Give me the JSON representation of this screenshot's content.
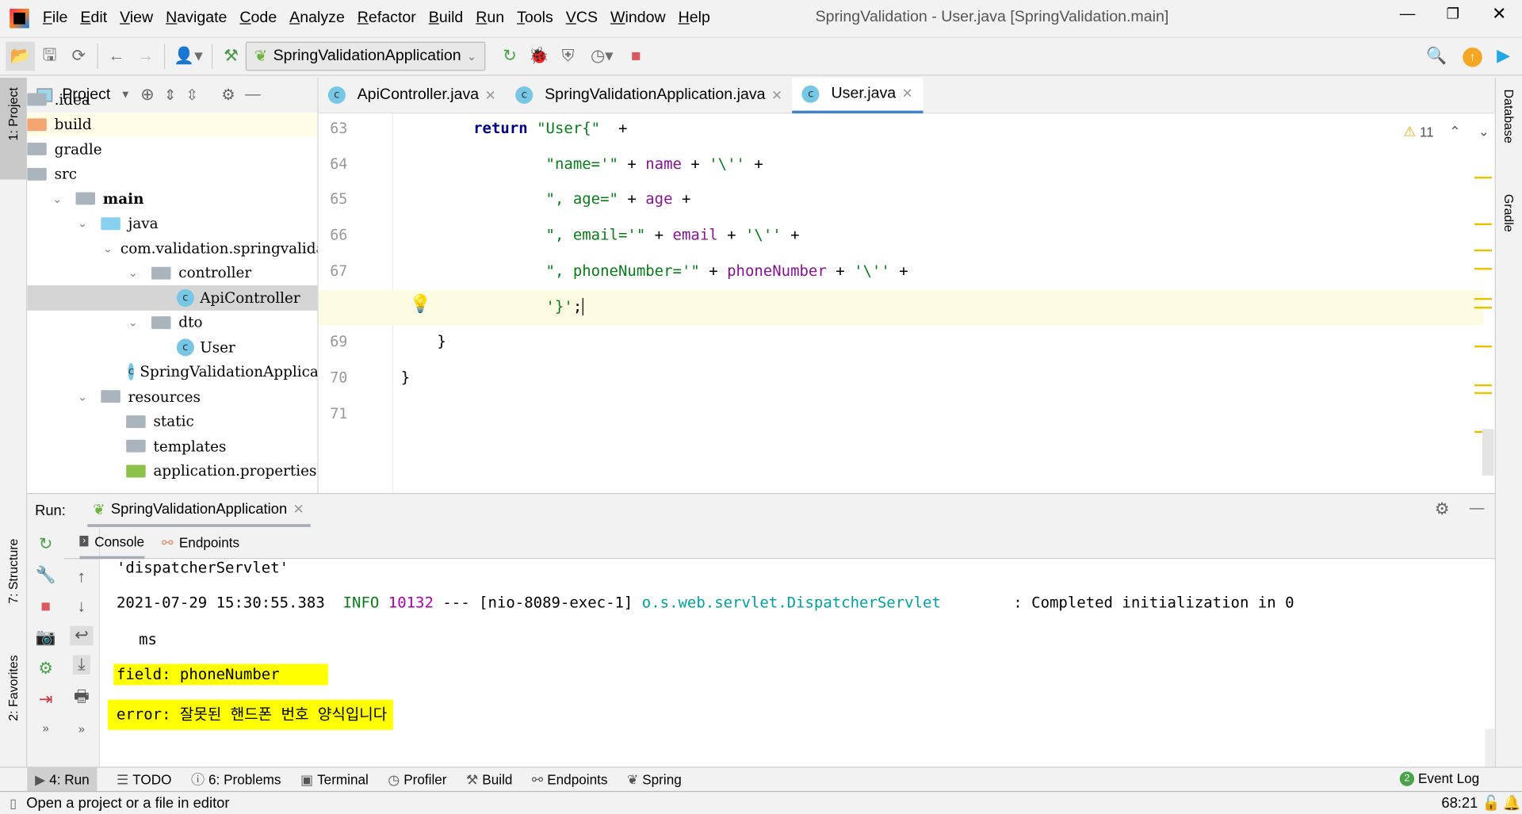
{
  "window": {
    "title": "SpringValidation - User.java [SpringValidation.main]"
  },
  "menu": [
    "File",
    "Edit",
    "View",
    "Navigate",
    "Code",
    "Analyze",
    "Refactor",
    "Build",
    "Run",
    "Tools",
    "VCS",
    "Window",
    "Help"
  ],
  "toolbar": {
    "run_config": "SpringValidationApplication"
  },
  "left_strip": {
    "project": "1: Project",
    "structure": "7: Structure",
    "favorites": "2: Favorites"
  },
  "right_strip": {
    "database": "Database",
    "gradle": "Gradle"
  },
  "project": {
    "title": "Project",
    "tree": [
      {
        "label": ".idea",
        "depth": 0,
        "icon": "folder"
      },
      {
        "label": "build",
        "depth": 0,
        "icon": "folder-orange"
      },
      {
        "label": "gradle",
        "depth": 0,
        "icon": "folder"
      },
      {
        "label": "src",
        "depth": 0,
        "icon": "folder"
      },
      {
        "label": "main",
        "depth": 1,
        "icon": "folder-source",
        "expanded": true
      },
      {
        "label": "java",
        "depth": 2,
        "icon": "folder-blue",
        "expanded": true
      },
      {
        "label": "com.validation.springvalidation",
        "depth": 3,
        "icon": "package",
        "expanded": true
      },
      {
        "label": "controller",
        "depth": 4,
        "icon": "package",
        "expanded": true
      },
      {
        "label": "ApiController",
        "depth": 5,
        "icon": "class",
        "selected": true
      },
      {
        "label": "dto",
        "depth": 4,
        "icon": "package",
        "expanded": true
      },
      {
        "label": "User",
        "depth": 5,
        "icon": "class"
      },
      {
        "label": "SpringValidationApplication",
        "depth": 4,
        "icon": "spring-class"
      },
      {
        "label": "resources",
        "depth": 2,
        "icon": "folder-resources",
        "expanded": true
      },
      {
        "label": "static",
        "depth": 3,
        "icon": "folder"
      },
      {
        "label": "templates",
        "depth": 3,
        "icon": "folder"
      },
      {
        "label": "application.properties",
        "depth": 3,
        "icon": "properties"
      }
    ]
  },
  "tabs": [
    {
      "label": "ApiController.java"
    },
    {
      "label": "SpringValidationApplication.java"
    },
    {
      "label": "User.java",
      "active": true
    }
  ],
  "editor": {
    "warnings": "11",
    "cursor_line": 68,
    "lines": [
      {
        "n": "63",
        "indent": "        ",
        "parts": [
          [
            "kw",
            "return "
          ],
          [
            "st",
            "\"User{\""
          ],
          [
            "",
            "  +"
          ]
        ]
      },
      {
        "n": "64",
        "indent": "                ",
        "parts": [
          [
            "st",
            "\"name='\""
          ],
          [
            "",
            " + "
          ],
          [
            "fd",
            "name"
          ],
          [
            "",
            " + "
          ],
          [
            "st",
            "'\\''"
          ],
          [
            "",
            " +"
          ]
        ]
      },
      {
        "n": "65",
        "indent": "                ",
        "parts": [
          [
            "st",
            "\", age=\""
          ],
          [
            "",
            " + "
          ],
          [
            "fd",
            "age"
          ],
          [
            "",
            " +"
          ]
        ]
      },
      {
        "n": "66",
        "indent": "                ",
        "parts": [
          [
            "st",
            "\", email='\""
          ],
          [
            "",
            " + "
          ],
          [
            "fd",
            "email"
          ],
          [
            "",
            " + "
          ],
          [
            "st",
            "'\\''"
          ],
          [
            "",
            " +"
          ]
        ]
      },
      {
        "n": "67",
        "indent": "                ",
        "parts": [
          [
            "st",
            "\", phoneNumber='\""
          ],
          [
            "",
            " + "
          ],
          [
            "fd",
            "phoneNumber"
          ],
          [
            "",
            " + "
          ],
          [
            "st",
            "'\\''"
          ],
          [
            "",
            " +"
          ]
        ]
      },
      {
        "n": "68",
        "indent": "                ",
        "parts": [
          [
            "st",
            "'}'"
          ],
          [
            "",
            ";"
          ]
        ]
      },
      {
        "n": "69",
        "indent": "    ",
        "parts": [
          [
            "",
            "}"
          ]
        ]
      },
      {
        "n": "70",
        "indent": "",
        "parts": [
          [
            "",
            "}"
          ]
        ]
      },
      {
        "n": "71",
        "indent": "",
        "parts": []
      }
    ]
  },
  "run": {
    "label": "Run:",
    "config": "SpringValidationApplication",
    "tabs": [
      "Console",
      "Endpoints"
    ],
    "console": {
      "line0": "'dispatcherServlet'",
      "ts": "2021-07-29 15:30:55.383",
      "level": "INFO",
      "pid": "10132",
      "sep": "---",
      "thread": "[nio-8089-exec-1]",
      "logger": "o.s.web.servlet.DispatcherServlet",
      "msg": ": Completed initialization in 0",
      "msg2": "ms",
      "field": "field: phoneNumber",
      "error": "error: 잘못된 핸드폰 번호 양식입니다"
    }
  },
  "bottom_tools": [
    {
      "label": "4: Run",
      "icon": "run"
    },
    {
      "label": "TODO",
      "icon": "list"
    },
    {
      "label": "6: Problems",
      "icon": "info"
    },
    {
      "label": "Terminal",
      "icon": "terminal"
    },
    {
      "label": "Profiler",
      "icon": "profiler"
    },
    {
      "label": "Build",
      "icon": "hammer"
    },
    {
      "label": "Endpoints",
      "icon": "endpoints"
    },
    {
      "label": "Spring",
      "icon": "spring"
    }
  ],
  "event_log": {
    "label": "Event Log",
    "count": "2"
  },
  "status": {
    "message": "Open a project or a file in editor",
    "position": "68:21"
  },
  "colors": {
    "keyword": "#000080",
    "string": "#067d17",
    "field": "#871094",
    "highlight": "#ffff00",
    "accent": "#4083c9"
  }
}
